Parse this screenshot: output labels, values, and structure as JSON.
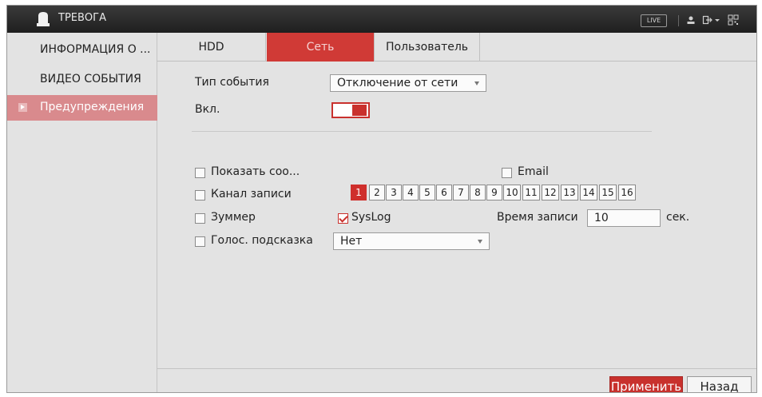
{
  "app": {
    "title": "ТРЕВОГА",
    "live_label": "LIVE"
  },
  "titlebar_icons": [
    "user-icon",
    "logout-icon",
    "qr-code-icon"
  ],
  "sidebar": {
    "items": [
      {
        "label": "ИНФОРМАЦИЯ О ..."
      },
      {
        "label": "ВИДЕО СОБЫТИЯ"
      },
      {
        "label": "Предупреждения",
        "active": true
      }
    ]
  },
  "tabs": [
    {
      "label": "HDD"
    },
    {
      "label": "Сеть",
      "active": true
    },
    {
      "label": "Пользователь"
    }
  ],
  "form": {
    "event_type_label": "Тип события",
    "event_type_value": "Отключение от сети",
    "enable_label": "Вкл.",
    "enable_on": true,
    "show_message_label": "Показать соо...",
    "show_message_checked": false,
    "email_label": "Email",
    "email_checked": false,
    "record_channel_label": "Канал записи",
    "channels": [
      "1",
      "2",
      "3",
      "4",
      "5",
      "6",
      "7",
      "8",
      "9",
      "10",
      "11",
      "12",
      "13",
      "14",
      "15",
      "16"
    ],
    "selected_channels": [
      "1"
    ],
    "buzzer_label": "Зуммер",
    "buzzer_checked": false,
    "syslog_label": "SysLog",
    "syslog_checked": true,
    "record_time_label": "Время записи",
    "record_time_value": "10",
    "record_time_unit": "сек.",
    "voice_prompt_label": "Голос. подсказка",
    "voice_prompt_checked": false,
    "voice_prompt_value": "Нет"
  },
  "buttons": {
    "apply": "Применить",
    "back": "Назад"
  },
  "colors": {
    "accent": "#d03a36",
    "sidebar_active": "#d98a8d",
    "titlebar": "#2a2a2a",
    "background": "#e3e3e3"
  }
}
